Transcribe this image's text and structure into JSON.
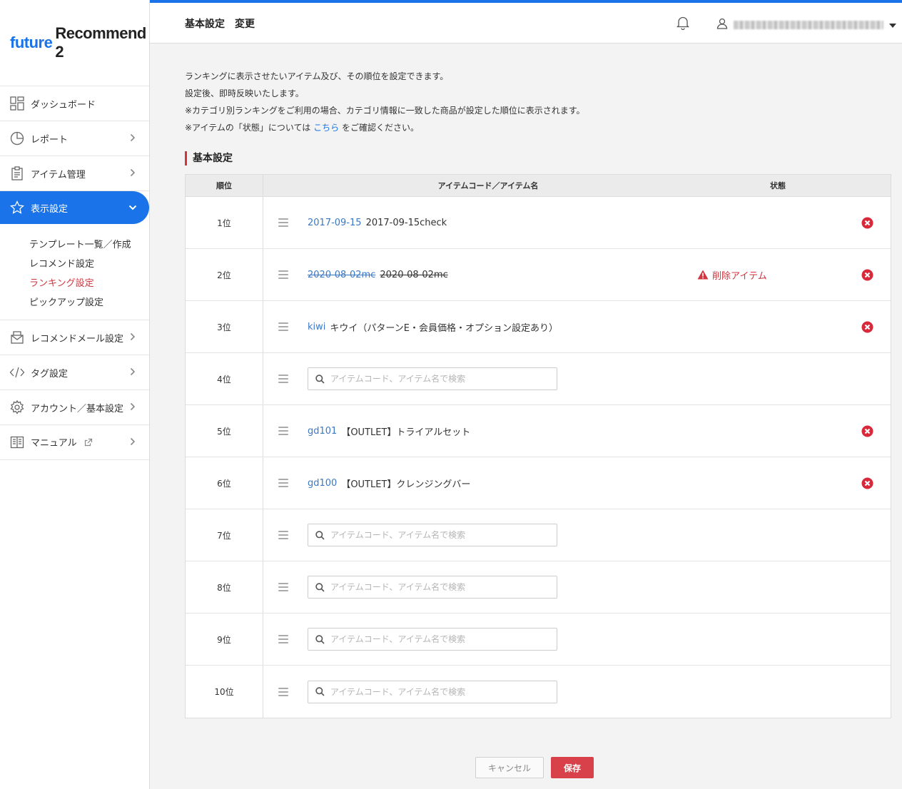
{
  "logo": {
    "part1": "future",
    "part2": "Recommend 2"
  },
  "header": {
    "title": "基本設定　変更"
  },
  "sidebar": {
    "items": [
      {
        "label": "ダッシュボード",
        "icon": "dashboard-icon"
      },
      {
        "label": "レポート",
        "icon": "pie-chart-icon"
      },
      {
        "label": "アイテム管理",
        "icon": "clipboard-icon"
      },
      {
        "label": "表示設定",
        "icon": "star-icon"
      },
      {
        "label": "レコメンドメール設定",
        "icon": "mail-icon"
      },
      {
        "label": "タグ設定",
        "icon": "code-icon"
      },
      {
        "label": "アカウント／基本設定",
        "icon": "gear-icon"
      },
      {
        "label": "マニュアル",
        "icon": "book-icon"
      }
    ],
    "sub_items": [
      {
        "label": "テンプレート一覧／作成"
      },
      {
        "label": "レコメンド設定"
      },
      {
        "label": "ランキング設定"
      },
      {
        "label": "ピックアップ設定"
      }
    ]
  },
  "description": {
    "line1": "ランキングに表示させたいアイテム及び、その順位を設定できます。",
    "line2": "設定後、即時反映いたします。",
    "line3": "※カテゴリ別ランキングをご利用の場合、カテゴリ情報に一致した商品が設定した順位に表示されます。",
    "line4_prefix": "※アイテムの「状態」については",
    "line4_link": "こちら",
    "line4_suffix": "をご確認ください。"
  },
  "section": {
    "title": "基本設定"
  },
  "table": {
    "headers": {
      "rank": "順位",
      "item": "アイテムコード／アイテム名",
      "status": "状態"
    },
    "search_placeholder": "アイテムコード、アイテム名で検索",
    "rows": [
      {
        "rank": "1位",
        "code": "2017-09-15",
        "name": "2017-09-15check",
        "status": ""
      },
      {
        "rank": "2位",
        "code": "2020-08-02mc",
        "name": "2020-08-02mc",
        "status": "削除アイテム"
      },
      {
        "rank": "3位",
        "code": "kiwi",
        "name": "キウイ（パターンE・会員価格・オプション設定あり）",
        "status": ""
      },
      {
        "rank": "4位",
        "search_value": ""
      },
      {
        "rank": "5位",
        "code": "gd101",
        "name": "【OUTLET】トライアルセット",
        "status": ""
      },
      {
        "rank": "6位",
        "code": "gd100",
        "name": "【OUTLET】クレンジングバー",
        "status": ""
      },
      {
        "rank": "7位",
        "search_value": ""
      },
      {
        "rank": "8位",
        "search_value": ""
      },
      {
        "rank": "9位",
        "search_value": ""
      },
      {
        "rank": "10位",
        "search_value": ""
      }
    ]
  },
  "buttons": {
    "cancel": "キャンセル",
    "save": "保存"
  },
  "colors": {
    "accent": "#1a73e8",
    "danger": "#d0363f",
    "link": "#3b78c4"
  }
}
